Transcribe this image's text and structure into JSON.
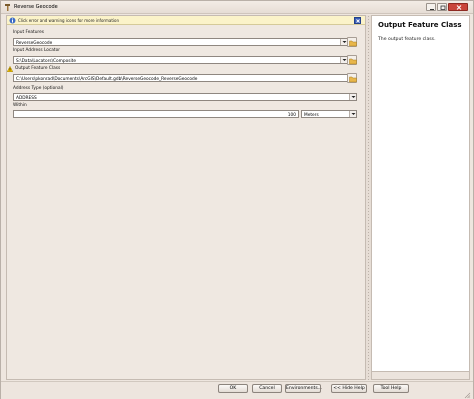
{
  "window": {
    "title": "Reverse Geocode"
  },
  "info_bar": {
    "text": "Click error and warning icons for more information"
  },
  "form": {
    "input_features": {
      "label": "Input Features",
      "value": "ReverseGeocode"
    },
    "input_address_locator": {
      "label": "Input Address Locator",
      "value": "S:\\Data\\Locators\\Composite"
    },
    "output_feature_class": {
      "label": "Output Feature Class",
      "value": "C:\\Users\\pkonrad\\Documents\\ArcGIS\\Default.gdb\\ReverseGeocode_ReverseGeocode"
    },
    "address_type": {
      "label": "Address Type (optional)",
      "value": "ADDRESS"
    },
    "within": {
      "label": "Within",
      "value": "100",
      "unit": "Meters"
    }
  },
  "help": {
    "title": "Output Feature Class",
    "body": "The output feature class."
  },
  "buttons": {
    "ok": "OK",
    "cancel": "Cancel",
    "environments": "Environments...",
    "hide_help": "<< Hide Help",
    "tool_help": "Tool Help"
  },
  "colors": {
    "info_bar": "#fbf3c9",
    "close_button": "#c9453b",
    "warning": "#f2c200"
  },
  "icons": [
    "hammer-icon",
    "info-icon",
    "close-icon",
    "folder-icon",
    "warning-icon",
    "chevron-down-icon",
    "resize-grip-icon"
  ]
}
